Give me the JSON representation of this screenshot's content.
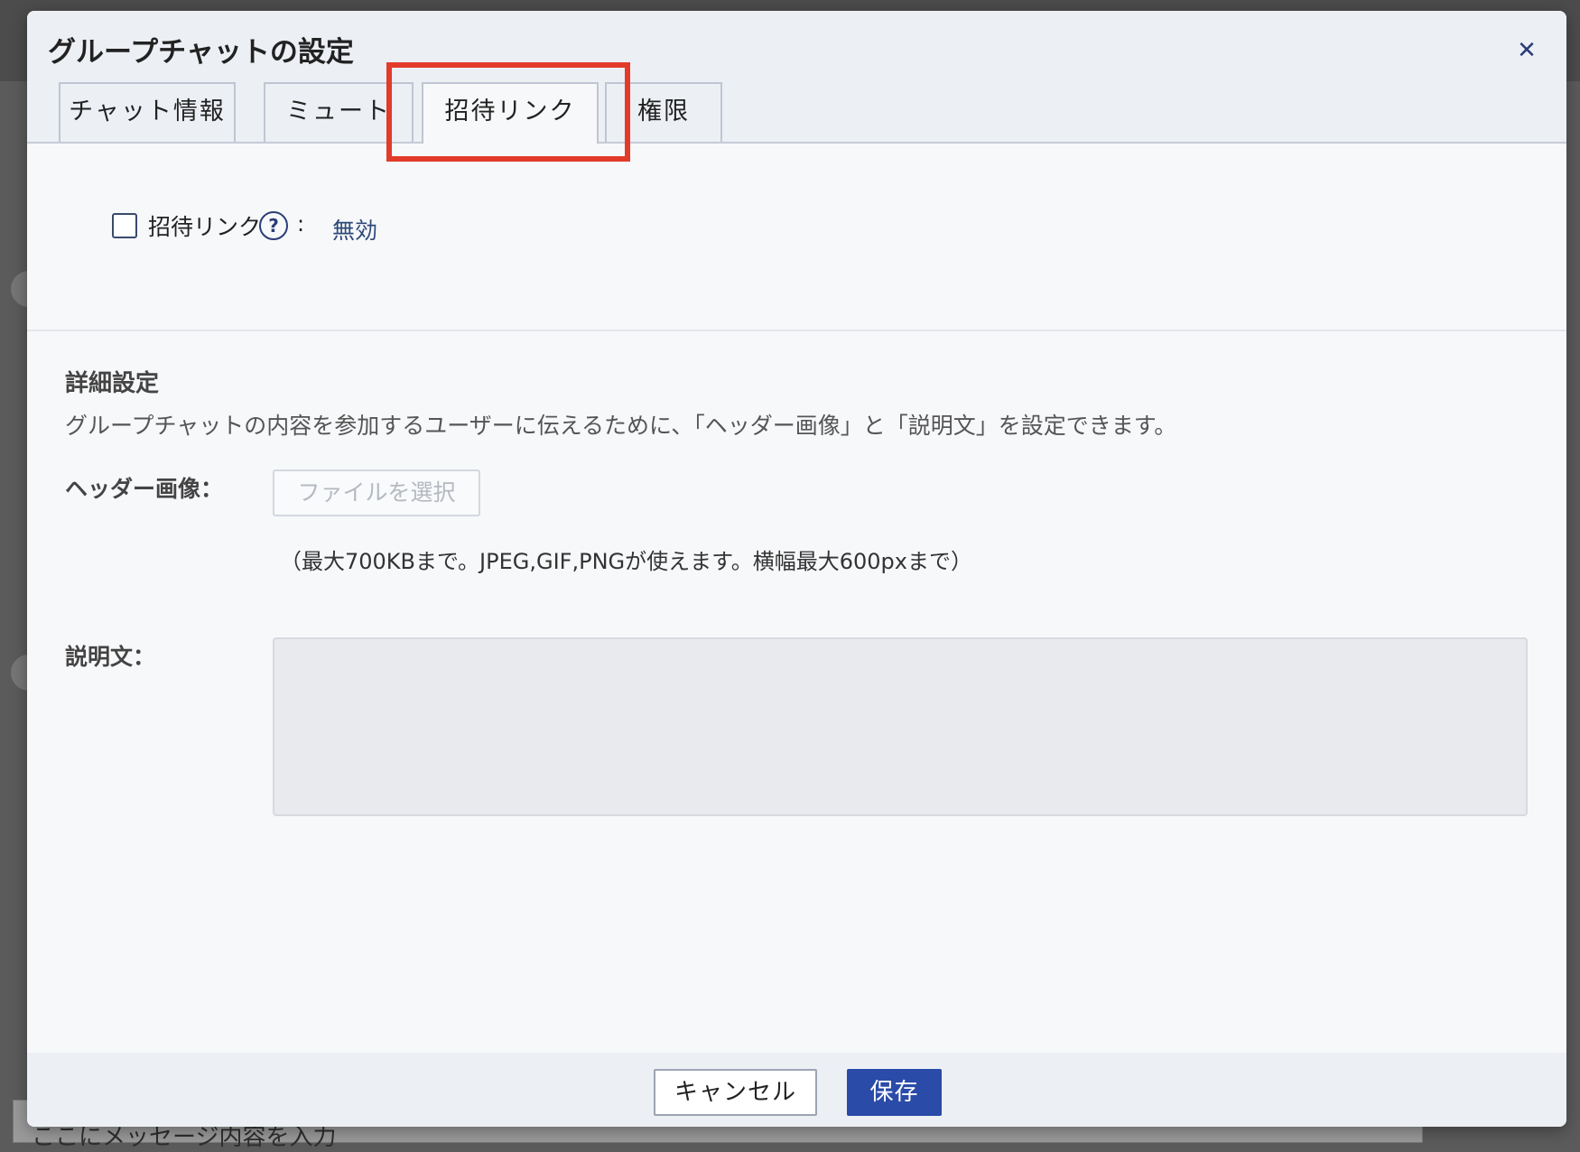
{
  "background": {
    "message_placeholder": "ここにメッセージ内容を入力"
  },
  "dialog": {
    "title": "グループチャットの設定",
    "close_icon": "close-icon",
    "tabs": [
      {
        "label": "チャット情報",
        "active": false
      },
      {
        "label": "ミュート",
        "active": false
      },
      {
        "label": "招待リンク",
        "active": true
      },
      {
        "label": "権限",
        "active": false
      }
    ],
    "highlight_color": "#e23b2a"
  },
  "invite": {
    "label": "招待リンク",
    "help_icon": "question-circle-icon",
    "help_glyph": "?",
    "colon": ":",
    "status": "無効",
    "checked": false
  },
  "details": {
    "title": "詳細設定",
    "description": "グループチャットの内容を参加するユーザーに伝えるために、「ヘッダー画像」と「説明文」を設定できます。",
    "header_image_label": "ヘッダー画像：",
    "file_button_label": "ファイルを選択",
    "file_note": "（最大700KBまで。JPEG,GIF,PNGが使えます。横幅最大600pxまで）",
    "description_label": "説明文：",
    "description_value": ""
  },
  "footer": {
    "cancel_label": "キャンセル",
    "save_label": "保存"
  },
  "colors": {
    "primary": "#2a4ba8",
    "link_text": "#2d4978",
    "icon": "#2b3d77"
  }
}
